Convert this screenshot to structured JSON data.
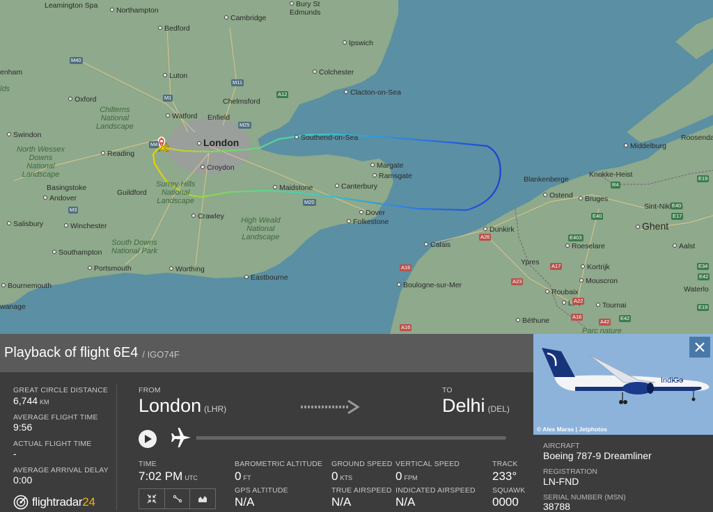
{
  "map": {
    "places": {
      "leamington": "Leamington Spa",
      "northampton": "Northampton",
      "bury": "Bury St\nEdmunds",
      "cambridge": "Cambridge",
      "bedford": "Bedford",
      "ipswich": "Ipswich",
      "luton": "Luton",
      "colchester": "Colchester",
      "henham": "enham",
      "oxford": "Oxford",
      "chelmsford": "Chelmsford",
      "clacton": "Clacton-on-Sea",
      "watford": "Watford",
      "enfield": "Enfield",
      "swindon": "Swindon",
      "london": "London",
      "southend": "Southend-on-Sea",
      "reading": "Reading",
      "croydon": "Croydon",
      "margate": "Margate",
      "ramsgate": "Ramsgate",
      "basingstoke": "Basingstoke",
      "andover": "Andover",
      "guildford": "Guildford",
      "maidstone": "Maidstone",
      "canterbury": "Canterbury",
      "salisbury": "Salisbury",
      "winchester": "Winchester",
      "crawley": "Crawley",
      "dover": "Dover",
      "folkestone": "Folkestone",
      "southampton": "Southampton",
      "portsmouth": "Portsmouth",
      "worthing": "Worthing",
      "bournemouth": "Bournemouth",
      "eastbourne": "Eastbourne",
      "wanage": "wanage",
      "calais": "Calais",
      "dunkirk": "Dunkirk",
      "boulogne": "Boulogne-sur-Mer",
      "middelburg": "Middelburg",
      "roosendaal": "Roosenda",
      "knokke": "Knokke-Heist",
      "blankenberge": "Blankenberge",
      "ostend": "Ostend",
      "bruges": "Bruges",
      "sintniklaas": "Sint-Niklaas",
      "ghent": "Ghent",
      "aalst": "Aalst",
      "roeselare": "Roeselare",
      "ypres": "Ypres",
      "kortrijk": "Kortrijk",
      "roubaix": "Roubaix",
      "mouscron": "Mouscron",
      "waterloo": "Waterlo",
      "lille": "Lille",
      "tournai": "Tournai",
      "bethune": "Béthune",
      "parcnaturel": "Parc nature"
    },
    "regions": {
      "chilterns": "Chilterns\nNational\nLandscape",
      "northwessex": "North Wessex\nDowns\nNational\nLandscape",
      "surreyhills": "Surrey Hills\nNational\nLandscape",
      "highweald": "High Weald\nNational\nLandscape",
      "southdowns": "South Downs\nNational Park",
      "lds": "lds"
    },
    "roads": [
      "M40",
      "M1",
      "M11",
      "A12",
      "M25",
      "M4",
      "M3",
      "M20",
      "A16",
      "A16",
      "A26",
      "A23",
      "A16",
      "A17",
      "E40",
      "E17",
      "E403",
      "E40",
      "E42",
      "E19",
      "E19",
      "A22",
      "E42",
      "A42",
      "R4",
      "E34"
    ]
  },
  "flight": {
    "title": "Playback of flight 6E4",
    "subtitle": "/ IGO74F",
    "great_circle_label": "GREAT CIRCLE DISTANCE",
    "great_circle_value": "6,744",
    "great_circle_unit": "KM",
    "avg_time_label": "AVERAGE FLIGHT TIME",
    "avg_time_value": "9:56",
    "actual_time_label": "ACTUAL FLIGHT TIME",
    "actual_time_value": "-",
    "avg_delay_label": "AVERAGE ARRIVAL DELAY",
    "avg_delay_value": "0:00",
    "from_label": "FROM",
    "from_city": "London",
    "from_code": "(LHR)",
    "to_label": "TO",
    "to_city": "Delhi",
    "to_code": "(DEL)",
    "time_label": "TIME",
    "time_value": "7:02 PM",
    "time_unit": "UTC",
    "baro_label": "BAROMETRIC ALTITUDE",
    "baro_value": "0",
    "baro_unit": "FT",
    "gps_label": "GPS ALTITUDE",
    "gps_value": "N/A",
    "gs_label": "GROUND SPEED",
    "gs_value": "0",
    "gs_unit": "KTS",
    "tas_label": "TRUE AIRSPEED",
    "tas_value": "N/A",
    "vs_label": "VERTICAL SPEED",
    "vs_value": "0",
    "vs_unit": "FPM",
    "ias_label": "INDICATED AIRSPEED",
    "ias_value": "N/A",
    "track_label": "TRACK",
    "track_value": "233°",
    "squawk_label": "SQUAWK",
    "squawk_value": "0000",
    "playback_progress": 0
  },
  "aircraft": {
    "photo_credit": "© Alex Maras | Jetphotos",
    "livery_text": "IndiGo",
    "aircraft_label": "AIRCRAFT",
    "aircraft_value": "Boeing 787-9 Dreamliner",
    "reg_label": "REGISTRATION",
    "reg_value": "LN-FND",
    "serial_label": "SERIAL NUMBER (MSN)",
    "serial_value": "38788"
  },
  "logo": {
    "text_main": "flightradar",
    "text_accent": "24"
  },
  "colors": {
    "panel_bg": "#3c3c3c",
    "header_bg": "#5a5a5a",
    "close_btn": "#4a79a8",
    "sea": "#5b8fa3",
    "land": "#8fa98d",
    "logo_accent": "#f5b400"
  }
}
